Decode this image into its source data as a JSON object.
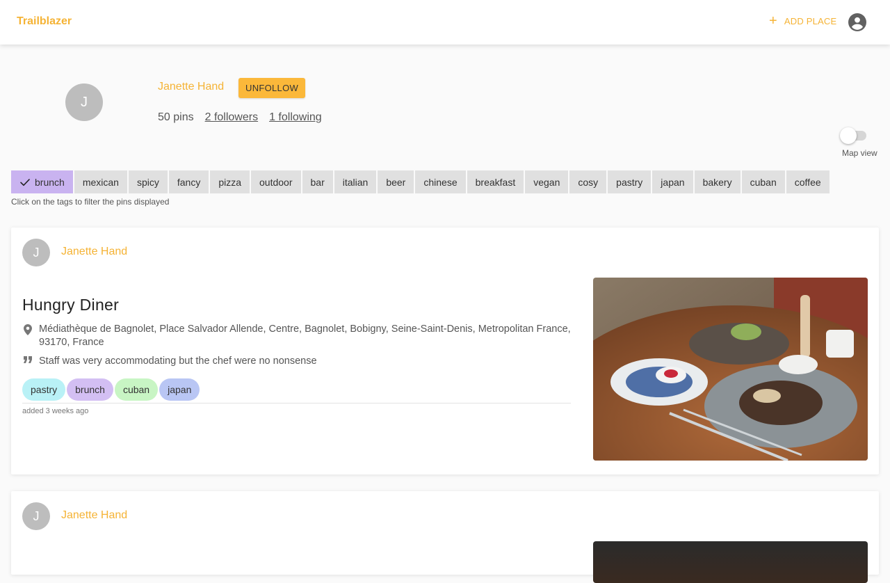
{
  "app": {
    "brand": "Trailblazer",
    "add_place_label": "ADD PLACE"
  },
  "profile": {
    "initial": "J",
    "name": "Janette Hand",
    "follow_button": "UNFOLLOW",
    "pins": "50 pins",
    "followers": "2 followers",
    "following": "1 following"
  },
  "map_toggle": {
    "label": "Map view",
    "on": false
  },
  "tags": [
    {
      "label": "brunch",
      "selected": true
    },
    {
      "label": "mexican",
      "selected": false
    },
    {
      "label": "spicy",
      "selected": false
    },
    {
      "label": "fancy",
      "selected": false
    },
    {
      "label": "pizza",
      "selected": false
    },
    {
      "label": "outdoor",
      "selected": false
    },
    {
      "label": "bar",
      "selected": false
    },
    {
      "label": "italian",
      "selected": false
    },
    {
      "label": "beer",
      "selected": false
    },
    {
      "label": "chinese",
      "selected": false
    },
    {
      "label": "breakfast",
      "selected": false
    },
    {
      "label": "vegan",
      "selected": false
    },
    {
      "label": "cosy",
      "selected": false
    },
    {
      "label": "pastry",
      "selected": false
    },
    {
      "label": "japan",
      "selected": false
    },
    {
      "label": "bakery",
      "selected": false
    },
    {
      "label": "cuban",
      "selected": false
    },
    {
      "label": "coffee",
      "selected": false
    }
  ],
  "tags_hint": "Click on the tags to filter the pins displayed",
  "pins": [
    {
      "user_initial": "J",
      "user": "Janette Hand",
      "title": "Hungry Diner",
      "address": "Médiathèque de Bagnolet, Place Salvador Allende, Centre, Bagnolet, Bobigny, Seine-Saint-Denis, Metropolitan France, 93170, France",
      "review": "Staff was very accommodating but the chef were no nonsense",
      "tags": [
        {
          "label": "pastry",
          "color": "#b9f1f6"
        },
        {
          "label": "brunch",
          "color": "#d3bff3"
        },
        {
          "label": "cuban",
          "color": "#c8f5c4"
        },
        {
          "label": "japan",
          "color": "#b9c6f4"
        }
      ],
      "added": "added 3 weeks ago"
    },
    {
      "user_initial": "J",
      "user": "Janette Hand"
    }
  ],
  "colors": {
    "accent": "#f5b335",
    "tag_bg": "#e0e0e0",
    "tag_selected": "#c9b3f0"
  }
}
